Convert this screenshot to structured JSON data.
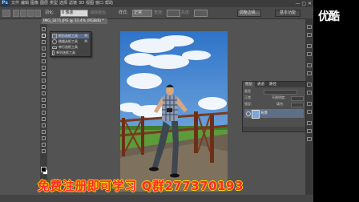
{
  "app": {
    "logo": "Ps",
    "menus": [
      "文件",
      "编辑",
      "图像",
      "图层",
      "类型",
      "选择",
      "滤镜",
      "3D",
      "视图",
      "窗口",
      "帮助"
    ],
    "window_controls": "—  ▢  ✕"
  },
  "options_bar": {
    "feather_label": "羽化:",
    "feather_value": "0 像素",
    "antialias_label": "消除锯齿",
    "style_label": "样式:",
    "style_value": "正常",
    "width_label": "宽度:",
    "height_label": "高度:",
    "refine_edge_button": "调整边缘...",
    "workspace": "基本功能"
  },
  "document_tab": "IMG_3271.JPG @ 33.4% (RGB/8) *",
  "tool_flyout": {
    "items": [
      {
        "label": "矩形选框工具",
        "key": "M"
      },
      {
        "label": "椭圆选框工具",
        "key": "M"
      },
      {
        "label": "单行选框工具",
        "key": ""
      },
      {
        "label": "单列选框工具",
        "key": ""
      }
    ]
  },
  "layers_panel": {
    "tabs": [
      "图层",
      "通道",
      "路径"
    ],
    "kind_label": "类型",
    "blend_mode": "正常",
    "opacity_label": "不透明度:",
    "lock_label": "锁定:",
    "fill_label": "填充:",
    "layer_name": "背景"
  },
  "watermark": {
    "logo": "优酷",
    "text": "免费注册即可学习 Q群277370193"
  },
  "colors": {
    "accent": "#5a6f8f",
    "watermark_fill": "#ff2a2a",
    "watermark_outline": "#ffd200"
  }
}
